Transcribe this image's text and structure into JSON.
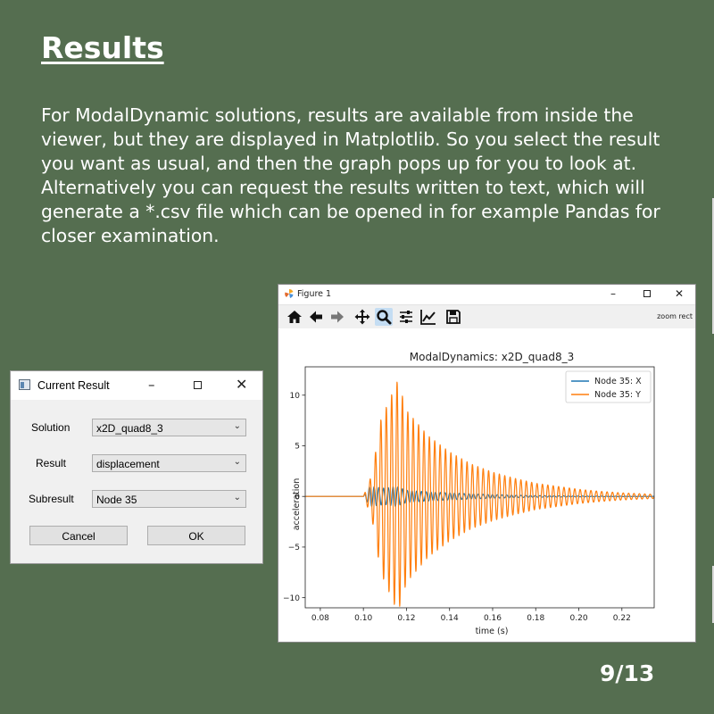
{
  "slide": {
    "title": "Results",
    "body": "For ModalDynamic solutions, results are available from inside the viewer, but they are displayed in Matplotlib. So you select the result you want as usual, and then the graph pops up for you to look at. Alternatively you can request the results written to text, which will generate a *.csv file which can be opened in for example Pandas for closer examination.",
    "page_number": "9/13"
  },
  "dialog": {
    "title": "Current Result",
    "fields": [
      {
        "label": "Solution",
        "value": "x2D_quad8_3"
      },
      {
        "label": "Result",
        "value": "displacement"
      },
      {
        "label": "Subresult",
        "value": "Node 35"
      }
    ],
    "cancel_label": "Cancel",
    "ok_label": "OK"
  },
  "figure": {
    "window_title": "Figure 1",
    "status_text": "zoom rect",
    "toolbar": [
      "home-icon",
      "back-arrow-icon",
      "forward-arrow-icon",
      "pan-icon",
      "zoom-icon",
      "subplots-icon",
      "axes-edit-icon",
      "save-icon"
    ],
    "active_tool": "zoom-icon"
  },
  "chart_data": {
    "type": "line",
    "title": "ModalDynamics: x2D_quad8_3",
    "xlabel": "time (s)",
    "ylabel": "acceleration",
    "xlim": [
      0.073,
      0.235
    ],
    "ylim": [
      -11.0,
      12.8
    ],
    "xticks": [
      "0.08",
      "0.10",
      "0.12",
      "0.14",
      "0.16",
      "0.18",
      "0.20",
      "0.22"
    ],
    "yticks": [
      "10",
      "5",
      "0",
      "−5",
      "−10"
    ],
    "legend_position": "top-right",
    "grid": false,
    "series": [
      {
        "name": "Node 35: X",
        "color": "#1f77b4",
        "t_start": 0.1,
        "baseline": 0.0,
        "envelope": {
          "t": [
            0.1,
            0.103,
            0.11,
            0.115,
            0.12,
            0.13,
            0.14,
            0.15,
            0.16,
            0.17,
            0.18,
            0.2,
            0.235
          ],
          "amp": [
            0.0,
            1.0,
            0.8,
            1.0,
            0.6,
            0.45,
            0.35,
            0.25,
            0.18,
            0.12,
            0.08,
            0.04,
            0.01
          ]
        },
        "period": 0.0022
      },
      {
        "name": "Node 35: Y",
        "color": "#ff7f0e",
        "t_start": 0.1,
        "baseline": 0.0,
        "envelope": {
          "t": [
            0.1,
            0.104,
            0.108,
            0.112,
            0.116,
            0.12,
            0.13,
            0.14,
            0.15,
            0.16,
            0.17,
            0.18,
            0.19,
            0.2,
            0.21,
            0.22,
            0.235
          ],
          "amp": [
            0.0,
            2.2,
            7.5,
            9.5,
            11.5,
            8.5,
            6.0,
            4.4,
            3.2,
            2.4,
            1.8,
            1.3,
            1.0,
            0.7,
            0.5,
            0.35,
            0.2
          ]
        },
        "period": 0.0025
      }
    ]
  }
}
